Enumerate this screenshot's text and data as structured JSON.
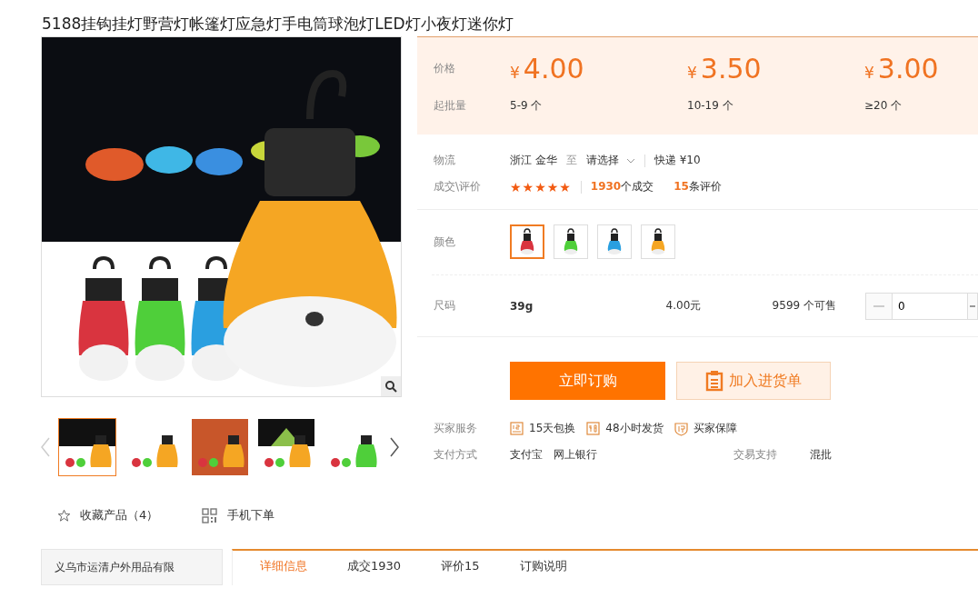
{
  "title": "5188挂钩挂灯野营灯帐篷灯应急灯手电筒球泡灯LED灯小夜灯迷你灯",
  "gallery": {
    "thumbnails": [
      {
        "selected": true
      },
      {
        "selected": false
      },
      {
        "selected": false
      },
      {
        "selected": false
      },
      {
        "selected": false
      }
    ]
  },
  "actions": [
    {
      "kind": "favorite",
      "label": "收藏产品（4）"
    },
    {
      "kind": "mobile",
      "label": "手机下单"
    }
  ],
  "prices": {
    "price_label": "价格",
    "moq_label": "起批量",
    "currency": "¥",
    "tiers": [
      {
        "price": "4.00",
        "quantity": "5-9 个"
      },
      {
        "price": "3.50",
        "quantity": "10-19 个"
      },
      {
        "price": "3.00",
        "quantity": "≥20 个"
      }
    ]
  },
  "logistics": {
    "label": "物流",
    "origin": "浙江 金华",
    "to": "至",
    "destination": "请选择",
    "shipping": "快递 ¥10"
  },
  "deals": {
    "label": "成交\\评价",
    "stars": 5,
    "count": "1930",
    "count_suffix": "个成交",
    "reviews": "15",
    "reviews_suffix": "条评价"
  },
  "color_option": {
    "label": "颜色",
    "swatches": [
      {
        "color": "#d9343f",
        "selected": true
      },
      {
        "color": "#4fcf3a",
        "selected": false
      },
      {
        "color": "#2a9fe0",
        "selected": false
      },
      {
        "color": "#f5a623",
        "selected": false
      }
    ]
  },
  "size_option": {
    "label": "尺码",
    "size": "39g",
    "price": "4.00元",
    "stock": "9599 个可售",
    "quantity": "0"
  },
  "buttons": {
    "buy": "立即订购",
    "cart": "加入进货单"
  },
  "services": {
    "label": "买家服务",
    "items": [
      {
        "kind": "return",
        "label": "15天包换"
      },
      {
        "kind": "ship",
        "label": "48小时发货"
      },
      {
        "kind": "guarantee",
        "label": "买家保障"
      }
    ]
  },
  "payment": {
    "label": "支付方式",
    "methods": [
      "支付宝",
      "网上银行"
    ],
    "trade_label": "交易支持",
    "trade_value": "混批"
  },
  "shop_box": {
    "name": "义乌市运清户外用品有限"
  },
  "detail_tabs": [
    {
      "label": "详细信息",
      "selected": true
    },
    {
      "label": "成交1930",
      "selected": false
    },
    {
      "label": "评价15",
      "selected": false
    },
    {
      "label": "订购说明",
      "selected": false
    }
  ]
}
